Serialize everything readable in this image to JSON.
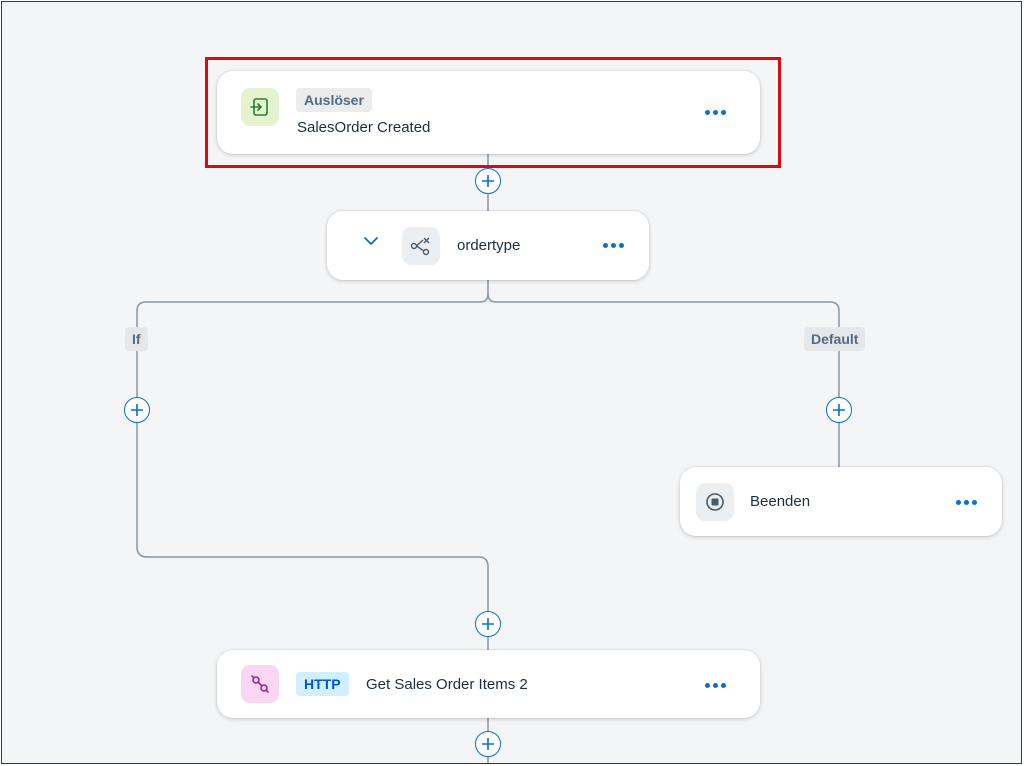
{
  "trigger": {
    "tag": "Auslöser",
    "title": "SalesOrder Created",
    "icon": "trigger-enter-icon"
  },
  "condition": {
    "title": "ordertype",
    "icon": "branch-condition-icon"
  },
  "branches": {
    "if_label": "If",
    "default_label": "Default"
  },
  "end_node": {
    "title": "Beenden",
    "icon": "stop-icon"
  },
  "http_node": {
    "tag": "HTTP",
    "title": "Get Sales Order Items 2",
    "icon": "http-link-icon"
  },
  "colors": {
    "accent": "#0a6ed1",
    "highlight": "#e0080f",
    "connector": "#8396a8",
    "trigger_icon_bg": "#e4f3cf",
    "http_icon_bg": "#fbd6f3"
  }
}
